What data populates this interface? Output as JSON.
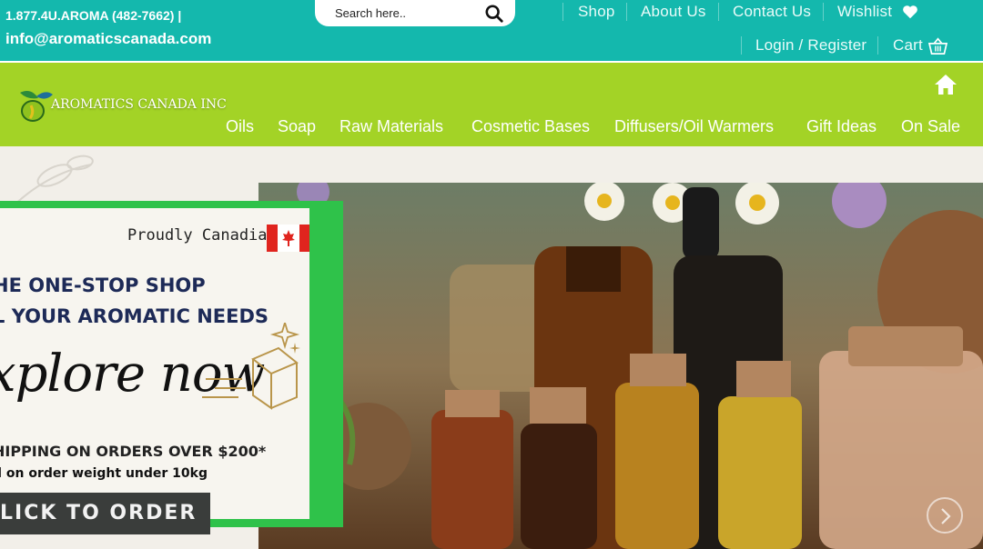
{
  "topbar": {
    "phone": "1.877.4U.AROMA (482-7662) |",
    "email": "info@aromaticscanada.com",
    "search_placeholder": "Search here..",
    "links": {
      "shop": "Shop",
      "about": "About Us",
      "contact": "Contact Us",
      "wishlist": "Wishlist",
      "login": "Login / Register",
      "cart": "Cart"
    }
  },
  "brand": {
    "name": "AROMATICS CANADA INC"
  },
  "nav": {
    "items": [
      "Oils",
      "Soap",
      "Raw Materials",
      "Cosmetic Bases",
      "Diffusers/Oil Warmers",
      "Gift Ideas",
      "On Sale"
    ]
  },
  "hero": {
    "proudly": "Proudly Canadian",
    "headline_1": "HE ONE-STOP SHOP",
    "headline_2": "L YOUR AROMATIC NEEDS",
    "explore": "xplore now",
    "shipping": "HIPPING ON ORDERS OVER $200*",
    "weight_note": "d on order weight under 10kg",
    "cta": "LICK TO ORDER"
  },
  "colors": {
    "topbar": "#14b8ad",
    "navbar": "#a3d326",
    "banner_border": "#2fc24a",
    "headline": "#1d2a57"
  }
}
